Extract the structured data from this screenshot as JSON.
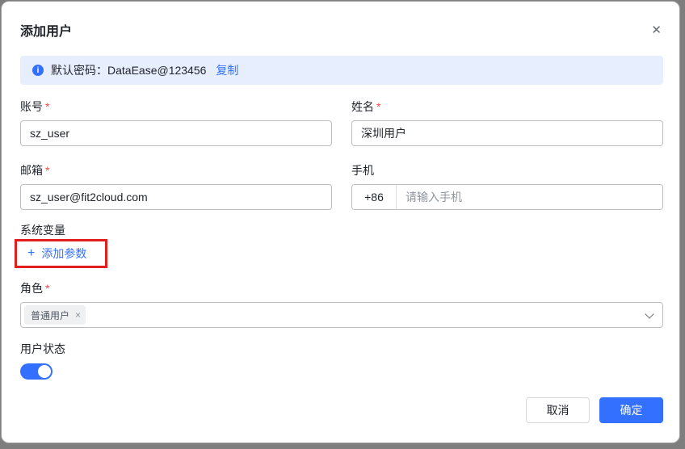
{
  "dialog": {
    "title": "添加用户",
    "close_icon": "✕"
  },
  "banner": {
    "info_icon": "i",
    "text": "默认密码：DataEase@123456",
    "copy_label": "复制"
  },
  "form": {
    "required_mark": "*",
    "account": {
      "label": "账号",
      "required": true,
      "value": "sz_user"
    },
    "name": {
      "label": "姓名",
      "required": true,
      "value": "深圳用户"
    },
    "email": {
      "label": "邮箱",
      "required": true,
      "value": "sz_user@fit2cloud.com"
    },
    "phone": {
      "label": "手机",
      "required": false,
      "prefix": "+86",
      "placeholder": "请输入手机"
    },
    "system_variables": {
      "label": "系统变量",
      "plus_icon": "+",
      "add_param_label": "添加参数"
    },
    "role": {
      "label": "角色",
      "required": true,
      "selected_tag": "普通用户",
      "tag_close_icon": "×"
    },
    "status": {
      "label": "用户状态",
      "enabled": true
    }
  },
  "footer": {
    "cancel_label": "取消",
    "confirm_label": "确定"
  },
  "colors": {
    "primary": "#3370ff",
    "banner_bg": "#e7eefd",
    "annotation_red": "#e21e1e",
    "required_red": "#f54a45",
    "input_border": "#bbbfc4"
  }
}
